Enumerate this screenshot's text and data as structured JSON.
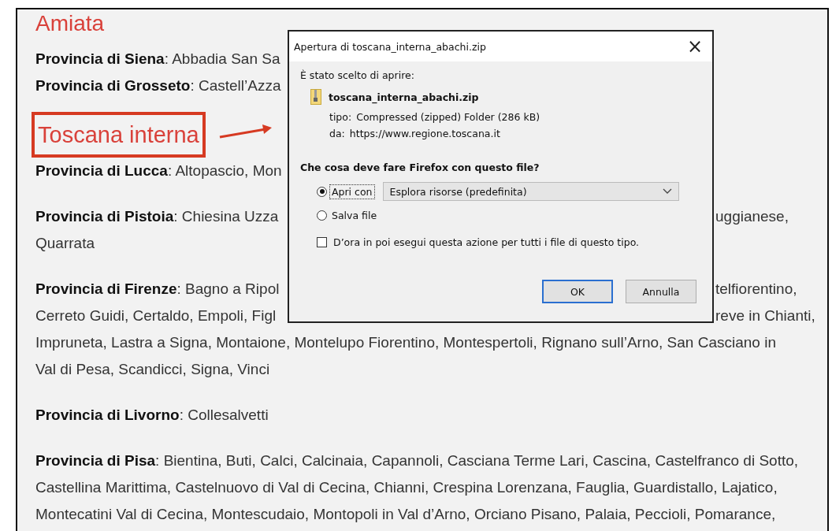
{
  "page": {
    "sections": [
      {
        "heading": "Amiata",
        "highlighted": false,
        "paragraphs": [
          {
            "lines": [
              {
                "text": "**Provincia di Siena**: Abbadia San Sa"
              }
            ]
          },
          {
            "lines": [
              {
                "text": "**Provincia di Grosseto**: Castell’Azza"
              }
            ]
          }
        ]
      },
      {
        "heading": "Toscana interna",
        "highlighted": true,
        "paragraphs": [
          {
            "lines": [
              {
                "text": "**Provincia di Lucca**: Altopascio, Mon"
              }
            ]
          },
          {
            "lines": [
              {
                "text": "**Provincia di Pistoia**: Chiesina Uzza",
                "after": "uggianese,"
              },
              {
                "text": "Quarrata"
              }
            ]
          },
          {
            "lines": [
              {
                "text": "**Provincia di Firenze**: Bagno a Ripol",
                "after": "telfiorentino,"
              },
              {
                "text": "Cerreto Guidi, Certaldo, Empoli, Figl",
                "after": "reve in Chianti,"
              },
              {
                "text": "Impruneta, Lastra a Signa, Montaione, Montelupo Fiorentino, Montespertoli, Rignano sull’Arno, San Casciano in"
              },
              {
                "text": "Val di Pesa, Scandicci, Signa, Vinci"
              }
            ]
          },
          {
            "lines": [
              {
                "text": "**Provincia di Livorno**: Collesalvetti"
              }
            ]
          },
          {
            "lines": [
              {
                "text": "**Provincia di Pisa**: Bientina, Buti, Calci, Calcinaia, Capannoli, Casciana Terme Lari, Cascina, Castelfranco di Sotto,"
              },
              {
                "text": "Castellina Marittima, Castelnuovo di Val di Cecina, Chianni, Crespina Lorenzana, Fauglia, Guardistallo, Lajatico,"
              },
              {
                "text": "Montecatini Val di Cecina, Montescudaio, Montopoli in Val d’Arno, Orciano Pisano, Palaia, Peccioli, Pomarance,"
              }
            ]
          }
        ]
      }
    ]
  },
  "dialog": {
    "title": "Apertura di toscana_interna_abachi.zip",
    "close": "×",
    "intro": "È stato scelto di aprire:",
    "file_name": "toscana_interna_abachi.zip",
    "details": [
      {
        "label": "tipo:",
        "value": "Compressed (zipped) Folder (286 kB)"
      },
      {
        "label": "da:",
        "value": "https://www.regione.toscana.it"
      }
    ],
    "question": "Che cosa deve fare Firefox con questo file?",
    "options": [
      {
        "label": "Apri con",
        "selected": true,
        "kind": "dropdown",
        "value": "Esplora risorse (predefinita)"
      },
      {
        "label": "Salva file",
        "selected": false,
        "kind": "plain"
      }
    ],
    "remember": {
      "label": "D’ora in poi esegui questa azione per tutti i file di questo tipo.",
      "checked": false
    },
    "buttons": [
      {
        "label": "OK",
        "default": true
      },
      {
        "label": "Annulla",
        "default": false
      }
    ]
  }
}
